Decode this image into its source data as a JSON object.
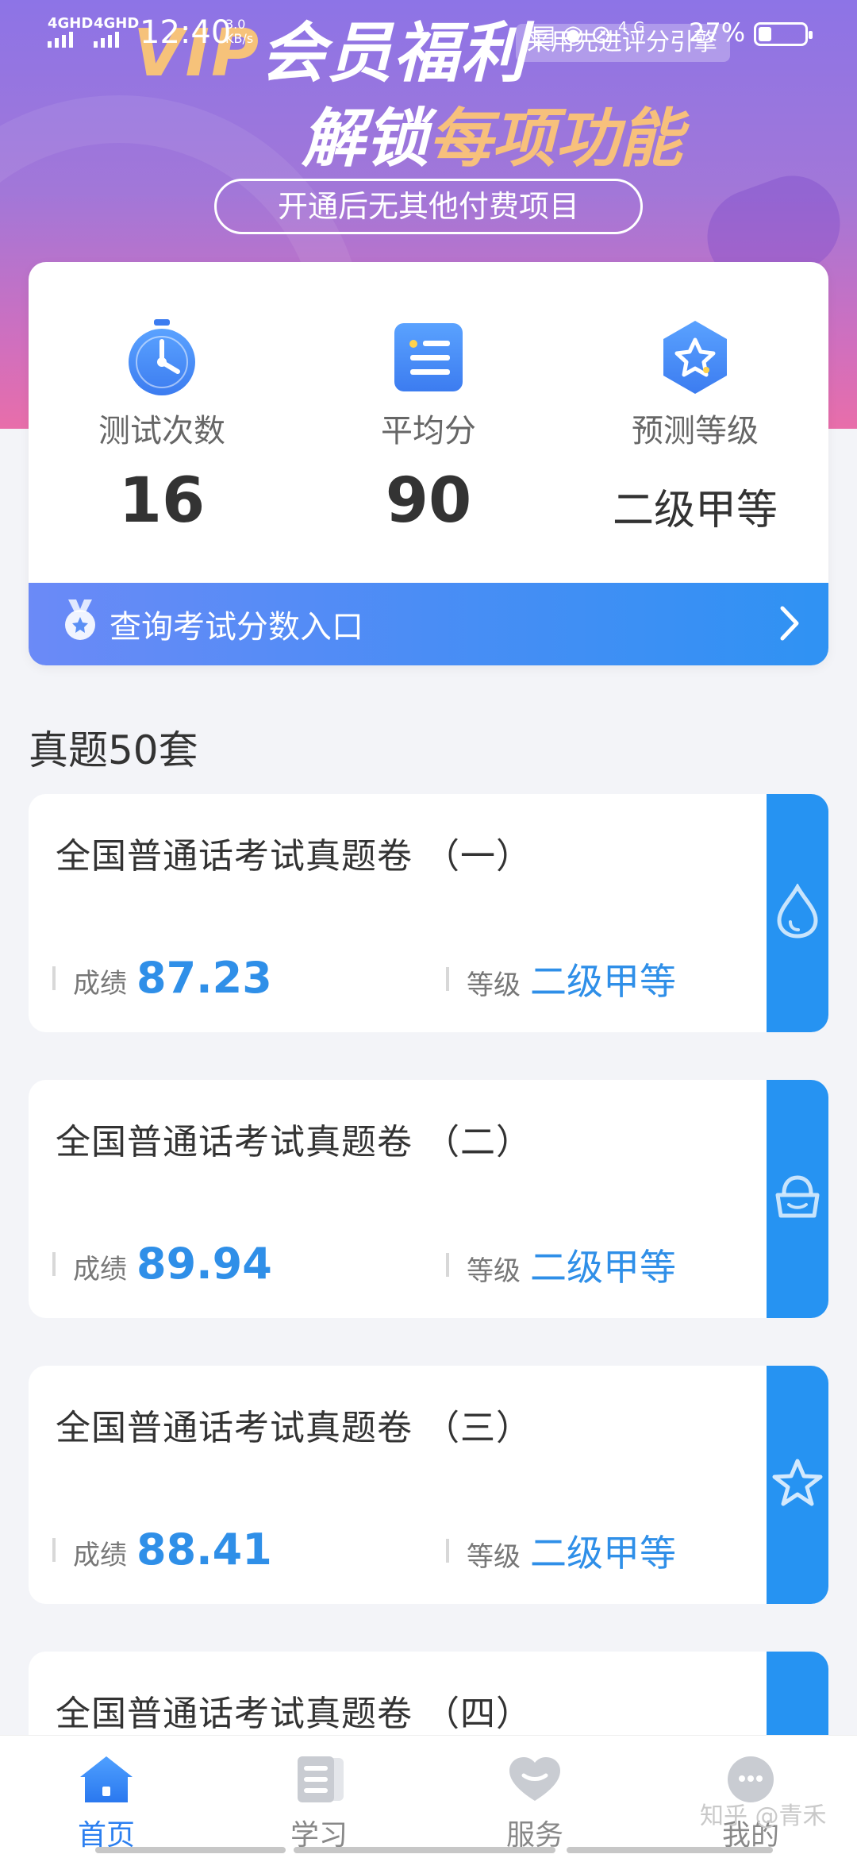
{
  "status_bar": {
    "network1": "4GHD",
    "network2": "4GHD",
    "time": "12:40",
    "speed": "3.0",
    "speed_unit": "KB/s",
    "battery": "27%",
    "icons": [
      "hd-icon",
      "eye-icon",
      "mute-icon",
      "4g-icon"
    ]
  },
  "banner": {
    "vip_prefix": "VIP",
    "vip_title": "会员福利",
    "search_hint": "采用先进评分引擎",
    "unlock_prefix": "解锁",
    "unlock_highlight": "每项功能",
    "pill_text": "开通后无其他付费项目"
  },
  "stats": [
    {
      "label": "测试次数",
      "value": "16",
      "icon": "stopwatch-icon"
    },
    {
      "label": "平均分",
      "value": "90",
      "icon": "list-icon"
    },
    {
      "label": "预测等级",
      "value": "二级甲等",
      "icon": "star-badge-icon"
    }
  ],
  "query": {
    "label": "查询考试分数入口"
  },
  "section": {
    "title": "真题50套"
  },
  "papers": [
    {
      "title": "全国普通话考试真题卷 （一）",
      "score_label": "成绩",
      "score": "87.23",
      "level_label": "等级",
      "level": "二级甲等",
      "side_icon": "drop-icon"
    },
    {
      "title": "全国普通话考试真题卷 （二）",
      "score_label": "成绩",
      "score": "89.94",
      "level_label": "等级",
      "level": "二级甲等",
      "side_icon": "bag-icon"
    },
    {
      "title": "全国普通话考试真题卷 （三）",
      "score_label": "成绩",
      "score": "88.41",
      "level_label": "等级",
      "level": "二级甲等",
      "side_icon": "star-icon"
    },
    {
      "title": "全国普通话考试真题卷 （四）"
    }
  ],
  "nav": [
    {
      "label": "首页",
      "icon": "home-icon",
      "active": true
    },
    {
      "label": "学习",
      "icon": "study-icon",
      "active": false
    },
    {
      "label": "服务",
      "icon": "heart-icon",
      "active": false
    },
    {
      "label": "我的",
      "icon": "profile-icon",
      "active": false
    }
  ],
  "watermark": "知乎 @青禾",
  "colors": {
    "accent": "#2693f2",
    "nav_active": "#2b7ff0",
    "banner_gold": "#f6c27a"
  }
}
